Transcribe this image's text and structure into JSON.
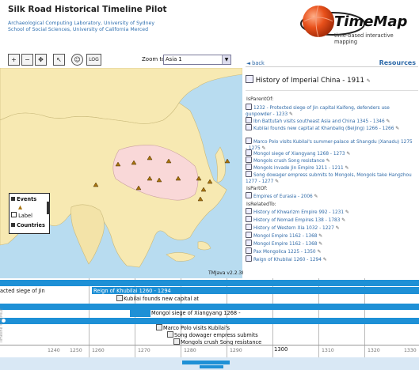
{
  "app": {
    "title": "Silk Road Historical Timeline Pilot",
    "subtitle1": "Archaeological Computing Laboratory, University of Sydney",
    "subtitle2": "School of Social Sciences, University of California Merced"
  },
  "logo": {
    "name": "TimeMap",
    "tagline": "time-based interactive mapping",
    "colors": {
      "sphere": "#e8501a",
      "ring": "#222222"
    }
  },
  "toolbar": {
    "zoom_in": "+",
    "zoom_out": "−",
    "pan": "✥",
    "select": "↖",
    "reset": "☺",
    "log": "LOG",
    "zoom_label": "Zoom to:",
    "zoom_value": "Asia 1"
  },
  "map": {
    "legend": {
      "events": "Events",
      "label": "Label",
      "countries": "Countries"
    },
    "watermark": "TMJava v2.2.38"
  },
  "sidebar": {
    "back": "back",
    "resources": "Resources",
    "title": "History of Imperial China - 1911",
    "is_parent_of_label": "IsParentOf:",
    "is_parent_of": [
      "1232 - Protected siege of Jin capital Kaifeng, defenders use gunpowder - 1233",
      "Ibn Battutah visits southeast Asia and China 1345 - 1346",
      "Kubilai founds new capital at Khanbaliq (Beijing) 1266 - 1266",
      "Marco Polo visits Kubilai's summer-palace at Shangdu (Xanadu) 1275 - 1275",
      "Mongol siege of Xiangyang 1268 - 1273",
      "Mongols crush Song resistance",
      "Mongols invade Jin Empire 1211 - 1211",
      "Song dowager empress submits to Mongols, Mongols take Hangzhou 1277 - 1277"
    ],
    "is_part_of_label": "IsPartOf:",
    "is_part_of": [
      "Empires of Eurasia - 2006"
    ],
    "is_related_to_label": "IsRelatedTo:",
    "is_related_to": [
      "History of Khwarizm Empire 992 - 1231",
      "History of Nomad Empires 138 - 1783",
      "History of Western Xia 1032 - 1227",
      "Mongol Empire 1162 - 1368",
      "Mongol Empire 1162 - 1368",
      "Pax Mongolica 1225 - 1350",
      "Reign of Khubilai 1260 - 1294"
    ]
  },
  "timeline": {
    "events": {
      "siege_jin": "acted siege of Jin",
      "reign": "Reign of Khubilai 1260 - 1294",
      "kubilai_capital": "Kubilai founds new capital at",
      "xiangyang": "Mongol siege of Xiangyang 1268 -",
      "marco": "Marco Polo visits Kubilai's",
      "dowager": "Song dowager empress submits",
      "crush": "Mongols crush Song resistance"
    },
    "ticks": [
      "1240",
      "1250",
      "1260",
      "1270",
      "1280",
      "1290",
      "1300",
      "1310",
      "1320",
      "1330"
    ],
    "side_label": "Timeline © SIMILE"
  }
}
